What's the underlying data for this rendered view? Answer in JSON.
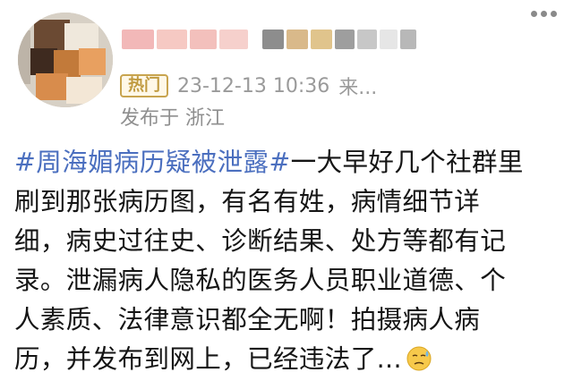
{
  "post": {
    "hot_badge": "热门",
    "timestamp": "23-12-13 10:36",
    "source": "来...",
    "location": "发布于 浙江",
    "hashtag": "#周海媚病历疑被泄露#",
    "text_lines": [
      "一大早好几个社群里",
      "刷到那张病历图，有名有姓，病情细节详",
      "细，病史过往史、诊断结果、处方等都有记",
      "录。泄漏病人隐私的医务人员职业道德、个",
      "人素质、法律意识都全无啊！拍摄病人病",
      "历，并发布到网上，已经违法了..."
    ],
    "emoji_icon": "cold-sweat-face-icon",
    "more_icon": "more-options-icon"
  },
  "colors": {
    "hashtag": "#4b6fbf",
    "badge_border": "#c8a44f",
    "meta_text": "#9a9a9a"
  }
}
